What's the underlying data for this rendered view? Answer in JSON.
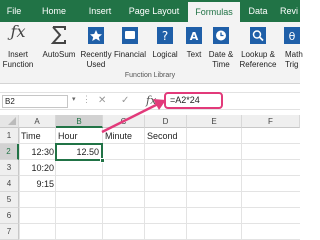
{
  "ribbon_tabs": [
    "File",
    "Home",
    "Insert",
    "Page Layout",
    "Formulas",
    "Data",
    "Revi"
  ],
  "active_tab": "Formulas",
  "ribbon_buttons": [
    {
      "line1": "Insert",
      "line2": "Function"
    },
    {
      "line1": "AutoSum",
      "line2": ""
    },
    {
      "line1": "Recently",
      "line2": "Used"
    },
    {
      "line1": "Financial",
      "line2": ""
    },
    {
      "line1": "Logical",
      "line2": ""
    },
    {
      "line1": "Text",
      "line2": ""
    },
    {
      "line1": "Date &",
      "line2": "Time"
    },
    {
      "line1": "Lookup &",
      "line2": "Reference"
    },
    {
      "line1": "Math",
      "line2": "Trig"
    }
  ],
  "group_label": "Function Library",
  "name_box": "B2",
  "fx_symbol": "fx",
  "formula": "=A2*24",
  "columns": [
    "A",
    "B",
    "C",
    "D",
    "E",
    "F"
  ],
  "rows": [
    "1",
    "2",
    "3",
    "4",
    "5",
    "6",
    "7"
  ],
  "cells": {
    "a1": "Time",
    "b1": "Hour",
    "c1": "Minute",
    "d1": "Second",
    "a2": "12:30",
    "b2": "12.50",
    "a3": "10:20",
    "a4": "9:15"
  },
  "colors": {
    "brand": "#217346",
    "callout": "#e23a7a",
    "fx_blue": "#1f5fa8"
  }
}
